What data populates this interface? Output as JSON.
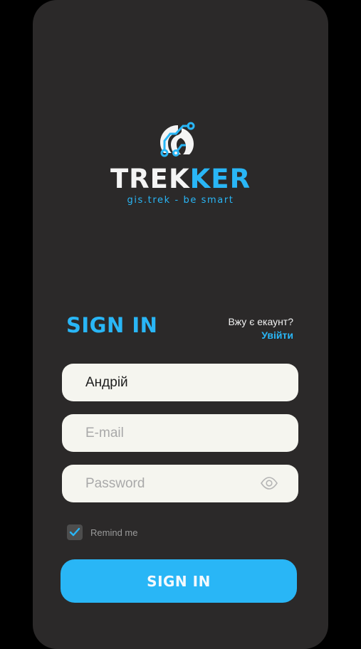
{
  "logo": {
    "brand_part1": "TREK",
    "brand_part2": "KER",
    "tagline": "gis.trek - be smart",
    "icon": "trekker-logo-icon"
  },
  "form": {
    "title": "SIGN IN",
    "have_account_question": "Вжу є екаунт?",
    "login_link": "Увійти",
    "name_value": "Андрій",
    "email_placeholder": "E-mail",
    "password_placeholder": "Password",
    "password_toggle_icon": "eye-icon",
    "remind_label": "Remind me",
    "remind_checked": true,
    "submit_label": "SIGN IN"
  },
  "colors": {
    "background": "#000000",
    "card": "#2b2929",
    "accent": "#29b6f6",
    "field": "#f5f5ef"
  }
}
